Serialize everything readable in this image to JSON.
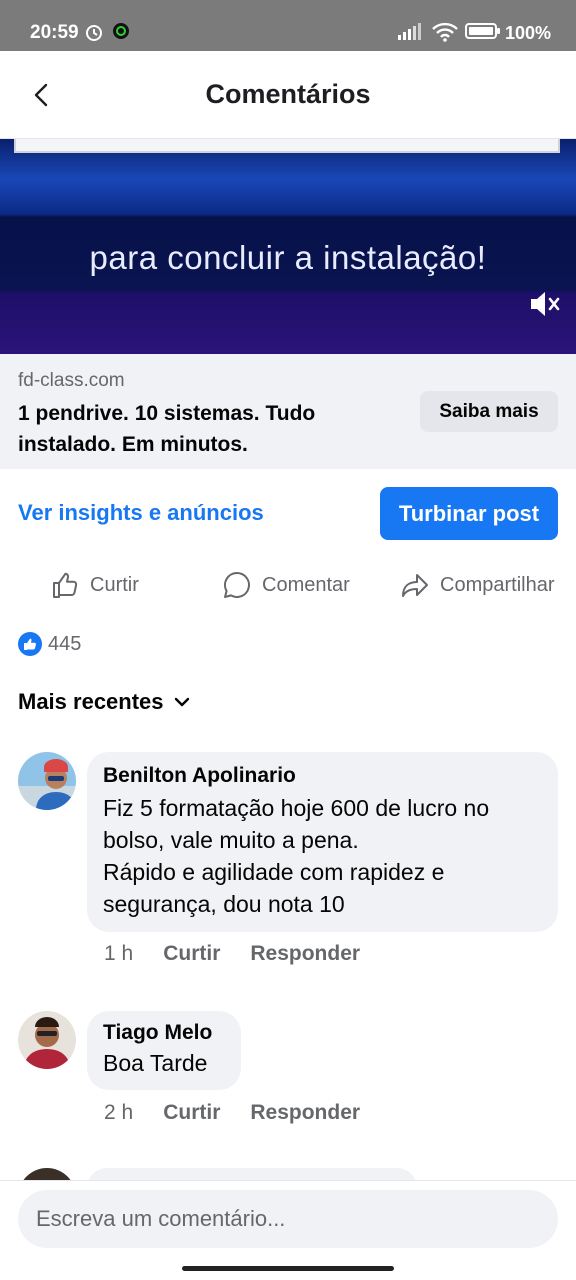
{
  "status_bar": {
    "time": "20:59",
    "battery": "100%"
  },
  "header": {
    "title": "Comentários"
  },
  "media": {
    "caption": "para concluir a instalação!"
  },
  "link_preview": {
    "domain": "fd-class.com",
    "headline": "1 pendrive. 10 sistemas. Tudo instalado. Em minutos.",
    "cta_label": "Saiba mais"
  },
  "post_tools": {
    "insights_label": "Ver insights e anúncios",
    "boost_label": "Turbinar post"
  },
  "actions": {
    "like": "Curtir",
    "comment": "Comentar",
    "share": "Compartilhar"
  },
  "reactions": {
    "count": "445"
  },
  "sort": {
    "label": "Mais recentes"
  },
  "comments": [
    {
      "author": "Benilton Apolinario",
      "text": "Fiz 5 formatação hoje 600 de lucro no bolso, vale muito a pena.\nRápido e agilidade com rapidez e segurança, dou nota 10",
      "time": "1 h",
      "like": "Curtir",
      "reply": "Responder"
    },
    {
      "author": "Tiago Melo",
      "text": "Boa Tarde",
      "time": "2 h",
      "like": "Curtir",
      "reply": "Responder"
    }
  ],
  "composer": {
    "placeholder": "Escreva um comentário..."
  },
  "colors": {
    "accent": "#1877f2",
    "bubble": "#f0f2f5",
    "muted": "#65676b"
  }
}
